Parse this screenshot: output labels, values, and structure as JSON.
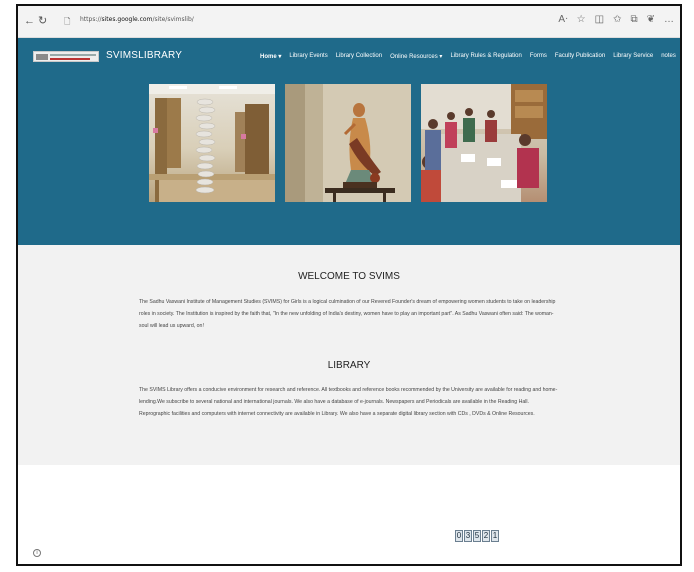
{
  "browser": {
    "url_prefix": "https://",
    "url_host": "sites.google.com",
    "url_path": "/site/svimslib/",
    "back_icon": "arrow-left-icon",
    "refresh_icon": "refresh-icon"
  },
  "site": {
    "title": "SVIMSLIBRARY",
    "nav": [
      "Home ▾",
      "Library Events",
      "Library Collection",
      "Online Resources ▾",
      "Library Rules & Regulation",
      "Forms",
      "Faculty Publication",
      "Library Service",
      "notes"
    ],
    "header_color": "#1f6a8a"
  },
  "main": {
    "welcome_heading": "WELCOME TO SVIMS",
    "welcome_text": "The Sadhu Vaswani Institute of Management Studies (SVIMS) for Girls is a logical culmination of our Revered Founder's dream of empowering women students to take on leadership roles in society. The Institution is inspired by the faith that, \"In the new unfolding of India's destiny, women have to play an important part\". As Sadhu Vaswani often said: The woman-soul will lead us upward, on!",
    "library_heading": "LIBRARY",
    "library_text": "The SVIMS Library offers a conducive environment for research and reference. All textbooks and reference books recommended by the University are available for reading and home-lending.We subscribe to several national and international journals. We also have a database of e-journals. Newspapers and Periodicals are available in the Reading Hall. Reprographic facilities and computers with internet connectivity are available in Library. We also have a separate digital library section with CDs , DVDs & Online Resources."
  },
  "counter": [
    "0",
    "3",
    "5",
    "2",
    "1"
  ]
}
